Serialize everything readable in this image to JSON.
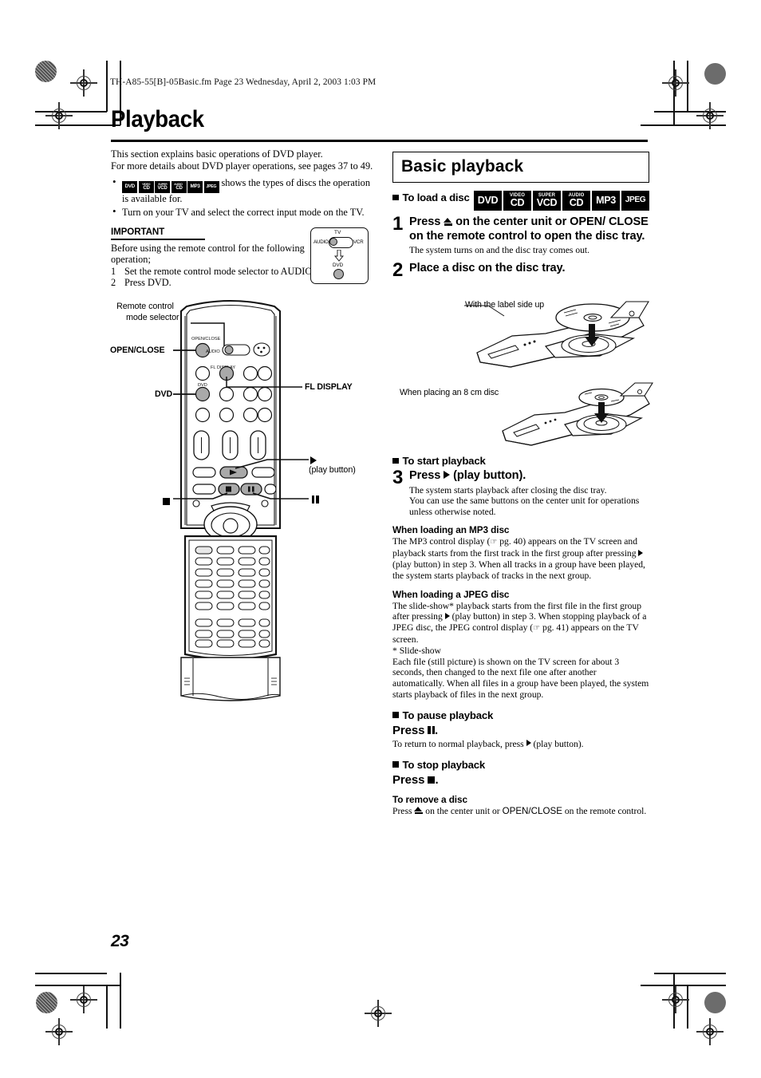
{
  "header": {
    "imprint": "TH-A85-55[B]-05Basic.fm  Page 23  Wednesday, April 2, 2003  1:03 PM"
  },
  "title": "Playback",
  "page_number": "23",
  "left": {
    "intro_line1": "This section explains basic operations of DVD player.",
    "intro_line2": "For more details about DVD player operations, see pages 37 to 49.",
    "bullet1_text": "shows the types of discs the operation is available for.",
    "bullet2_text": "Turn on your TV and select the correct input mode on the TV.",
    "important_heading": "IMPORTANT",
    "important_body": "Before using the remote control for the following operation;",
    "important_steps": [
      {
        "n": "1",
        "text": "Set the remote control mode selector to AUDIO."
      },
      {
        "n": "2",
        "text": "Press DVD."
      }
    ],
    "mode_box": {
      "tv": "TV",
      "audio": "AUDIO",
      "vcr": "VCR",
      "dvd": "DVD"
    },
    "remote_callouts": {
      "mode_selector_line1": "Remote control",
      "mode_selector_line2": "mode selector",
      "open_close": "OPEN/CLOSE",
      "dvd": "DVD",
      "fl_display": "FL DISPLAY",
      "play_button_note": "(play button)",
      "open_close_small": "OPEN/CLOSE",
      "audio_small": "AUDIO",
      "fl_display_small": "FL DISPLAY",
      "dvd_small": "DVD"
    }
  },
  "disc_badges": [
    {
      "top": "",
      "bottom": "DVD"
    },
    {
      "top": "VIDEO",
      "bottom": "CD"
    },
    {
      "top": "SUPER",
      "bottom": "VCD"
    },
    {
      "top": "AUDIO",
      "bottom": "CD"
    },
    {
      "top": "",
      "bottom": "MP3"
    },
    {
      "top": "",
      "bottom": "JPEG"
    }
  ],
  "right": {
    "section_title": "Basic playback",
    "to_load_a_disc": "To load a disc",
    "step1": {
      "num": "1",
      "head_a": "Press ",
      "head_b": " on the center unit or OPEN/ CLOSE on the remote control to open the disc tray.",
      "note": "The system turns on and the disc tray comes out."
    },
    "step2": {
      "num": "2",
      "head": "Place a disc on the disc tray."
    },
    "illus_label_1": "With the label side up",
    "illus_label_2": "When placing an 8 cm disc",
    "to_start_playback": "To start playback",
    "step3": {
      "num": "3",
      "head_a": "Press ",
      "head_b": " (play button).",
      "note_line1": "The system starts playback after closing the disc tray.",
      "note_line2": "You can use the same buttons on the center unit for operations unless otherwise noted."
    },
    "mp3_head": "When loading an MP3 disc",
    "mp3_body_a": "The MP3 control display (",
    "mp3_body_pg": " pg. 40) appears on the TV screen and playback starts from the first track in the first group after pressing ",
    "mp3_body_b": " (play button) in step 3. When all tracks in a group have been played, the system starts playback of tracks in the next group.",
    "jpeg_head": "When loading a JPEG disc",
    "jpeg_body_a": "The slide-show* playback starts from the first file in the first group after pressing ",
    "jpeg_body_b": " (play button) in step 3. When stopping playback of a JPEG disc, the JPEG control display (",
    "jpeg_body_pg": " pg. 41) appears on the TV screen.",
    "slideshow_note_head": "*  Slide-show",
    "slideshow_note_body": "Each file (still picture) is shown on the TV screen for about 3 seconds, then changed to the next file one after another automatically. When all files in a group have been played, the system starts playback of files in the next group.",
    "to_pause_playback": "To pause playback",
    "press_pause": "Press",
    "pause_note": "To return to normal playback, press ",
    "pause_note_b": " (play button).",
    "to_stop_playback": "To stop playback",
    "press_stop": "Press",
    "remove_head": "To remove a disc",
    "remove_a": "Press ",
    "remove_b": " on the center unit or ",
    "remove_openclose": "OPEN/CLOSE",
    "remove_c": " on the remote control."
  },
  "colors": {
    "ink": "#000000",
    "paper": "#ffffff",
    "button_gray": "#a9a9a9",
    "reg_gray": "#6c6c6c"
  }
}
